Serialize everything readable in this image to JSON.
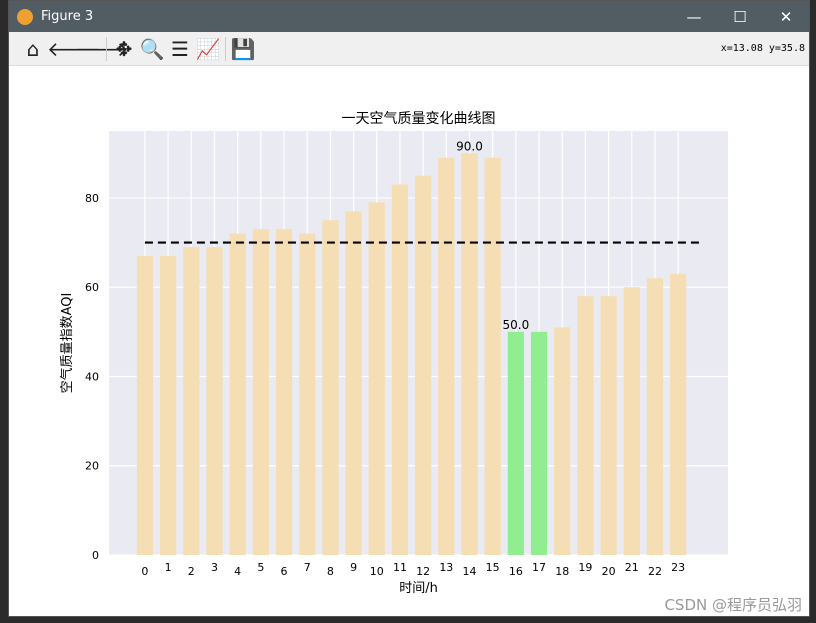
{
  "window": {
    "title": "Figure 3",
    "coords": "x=13.08 y=35.8"
  },
  "toolbar": [
    "home-icon",
    "back-icon",
    "forward-icon",
    "pan-icon",
    "zoom-icon",
    "configure-icon",
    "edit-axis-icon",
    "save-icon"
  ],
  "watermark": "CSDN @程序员弘羽",
  "chart_data": {
    "type": "bar",
    "title": "一天空气质量变化曲线图",
    "xlabel": "时间/h",
    "ylabel": "空气质量指数AQI",
    "categories": [
      "0",
      "1",
      "2",
      "3",
      "4",
      "5",
      "6",
      "7",
      "8",
      "9",
      "10",
      "11",
      "12",
      "13",
      "14",
      "15",
      "16",
      "17",
      "18",
      "19",
      "20",
      "21",
      "22",
      "23"
    ],
    "values": [
      67,
      67,
      69,
      69,
      72,
      73,
      73,
      72,
      75,
      77,
      79,
      83,
      85,
      89,
      90,
      89,
      50,
      50,
      51,
      58,
      58,
      60,
      62,
      63
    ],
    "colors": {
      "default": "#f5deb3",
      "min": "#90ee90",
      "mean_line": "#000000",
      "background": "#eaeaf2"
    },
    "highlight_min": [
      16,
      17
    ],
    "data_labels": [
      {
        "index": 14,
        "text": "90.0"
      },
      {
        "index": 16,
        "text": "50.0"
      }
    ],
    "mean_line": {
      "value": 70,
      "x_range": [
        0,
        24
      ],
      "style": "dashed"
    },
    "xlim": [
      -1.55,
      25.15
    ],
    "ylim": [
      0,
      95
    ],
    "yticks": [
      0,
      20,
      40,
      60,
      80
    ],
    "grid": true
  }
}
